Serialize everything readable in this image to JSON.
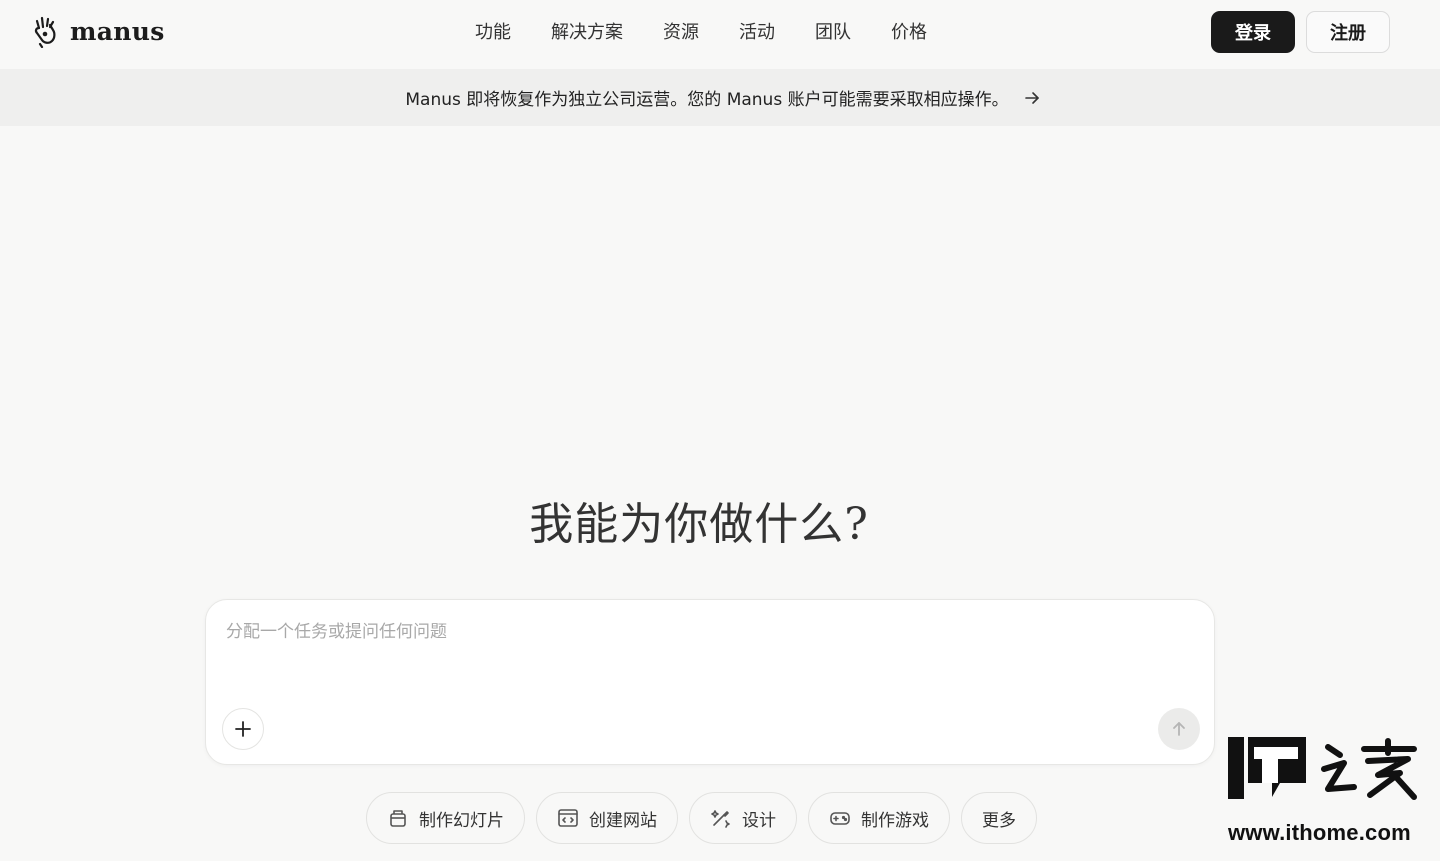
{
  "brand": {
    "name": "manus"
  },
  "nav": {
    "items": [
      "功能",
      "解决方案",
      "资源",
      "活动",
      "团队",
      "价格"
    ]
  },
  "auth": {
    "login_label": "登录",
    "signup_label": "注册"
  },
  "banner": {
    "text": "Manus 即将恢复作为独立公司运营。您的 Manus 账户可能需要采取相应操作。"
  },
  "hero": {
    "title": "我能为你做什么?"
  },
  "composer": {
    "placeholder": "分配一个任务或提问任何问题"
  },
  "chips": [
    {
      "label": "制作幻灯片",
      "icon": "slides-icon"
    },
    {
      "label": "创建网站",
      "icon": "website-icon"
    },
    {
      "label": "设计",
      "icon": "design-icon"
    },
    {
      "label": "制作游戏",
      "icon": "gamepad-icon"
    },
    {
      "label": "更多",
      "icon": ""
    }
  ],
  "watermark": {
    "logo": "IT之家",
    "url": "www.ithome.com"
  }
}
